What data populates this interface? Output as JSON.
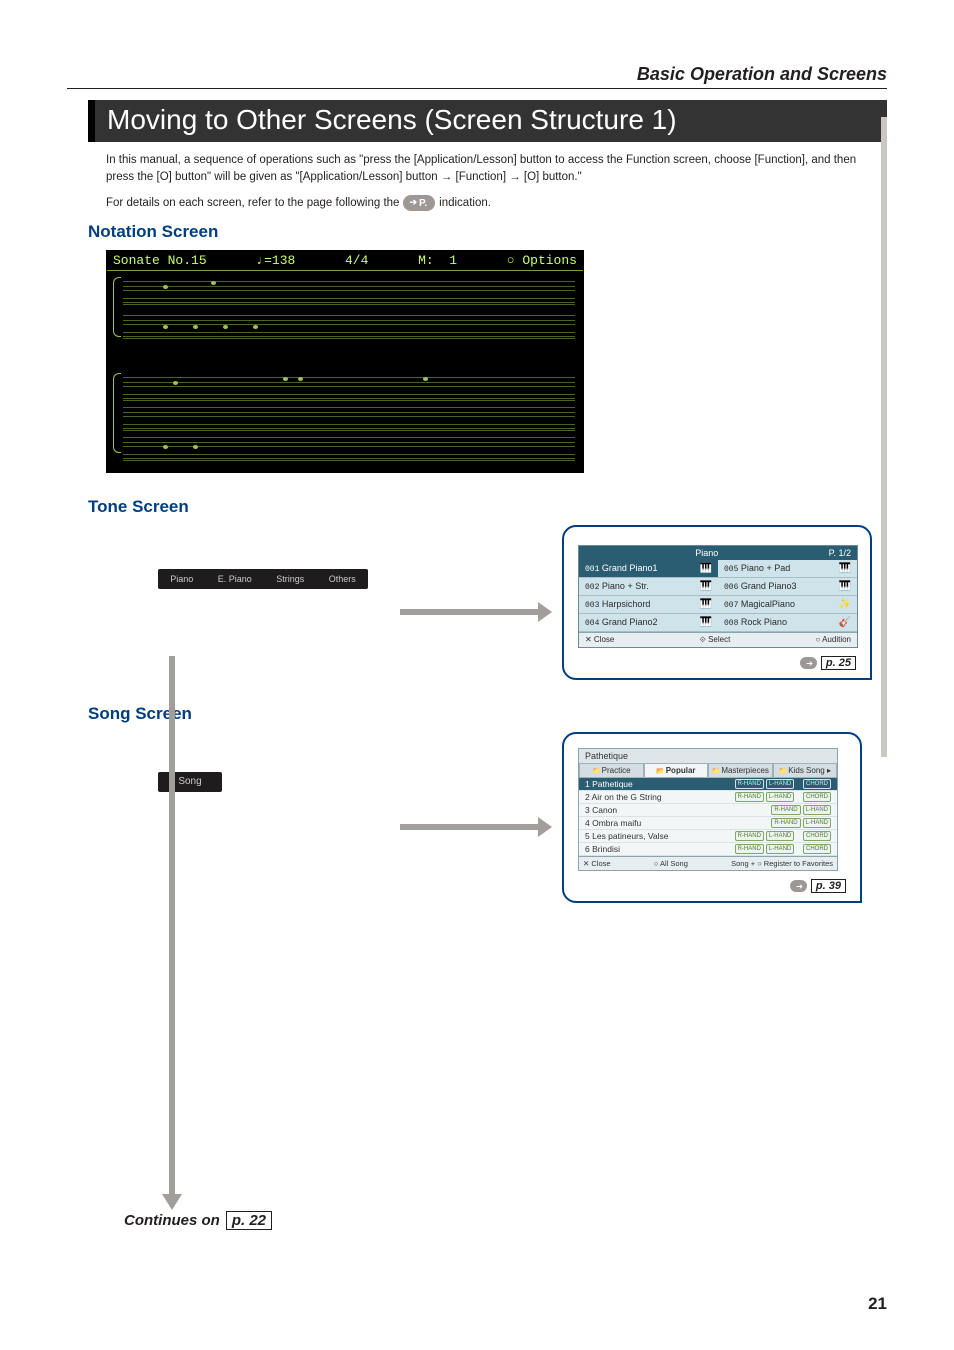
{
  "running_header": "Basic Operation and Screens",
  "section_title": "Moving to Other Screens (Screen Structure 1)",
  "intro_p1": "In this manual, a sequence of operations such as \"press the [Application/Lesson] button to access the Function screen, choose [Function], and then press the [O] button\" will be given as \"[Application/Lesson] button → [Function] → [O] button.\"",
  "intro_p2a": "For details on each screen, refer to the page following the",
  "intro_pill": "P.",
  "intro_p2b": "indication.",
  "notation": {
    "heading": "Notation Screen",
    "title": "Sonate No.15",
    "tempo": "♩=138",
    "timesig": "4/4",
    "measure": "M:  1",
    "options": "○ Options"
  },
  "tone": {
    "heading": "Tone Screen",
    "bar": [
      "Piano",
      "E. Piano",
      "Strings",
      "Others"
    ],
    "head_c": "Piano",
    "head_r": "P. 1/2",
    "items": [
      {
        "no": "001",
        "name": "Grand Piano1",
        "sel": true
      },
      {
        "no": "005",
        "name": "Piano + Pad"
      },
      {
        "no": "002",
        "name": "Piano + Str."
      },
      {
        "no": "006",
        "name": "Grand Piano3"
      },
      {
        "no": "003",
        "name": "Harpsichord"
      },
      {
        "no": "007",
        "name": "MagicalPiano"
      },
      {
        "no": "004",
        "name": "Grand Piano2"
      },
      {
        "no": "008",
        "name": "Rock Piano"
      }
    ],
    "foot": [
      "✕ Close",
      "⟐ Select",
      "○ Audition"
    ],
    "page_ref": "p. 25"
  },
  "song": {
    "heading": "Song Screen",
    "bar": "Song",
    "title": "Pathetique",
    "tabs": [
      {
        "label": "Practice",
        "icon": "📁"
      },
      {
        "label": "Popular",
        "icon": "📂",
        "active": true
      },
      {
        "label": "Masterpieces",
        "icon": "📁"
      },
      {
        "label": "Kids Song",
        "icon": "📁",
        "arrow": "▸"
      }
    ],
    "rows": [
      {
        "n": "1",
        "t": "Pathetique",
        "sel": true,
        "b": [
          "R-HAND",
          "L-HAND"
        ],
        "c": [
          "CHORD"
        ]
      },
      {
        "n": "2",
        "t": "Air on the G String",
        "b": [
          "R-HAND",
          "L-HAND"
        ],
        "c": [
          "CHORD"
        ]
      },
      {
        "n": "3",
        "t": "Canon",
        "b": [
          "R-HAND",
          "L-HAND"
        ],
        "c": []
      },
      {
        "n": "4",
        "t": "Ombra maifu",
        "b": [
          "R-HAND",
          "L-HAND"
        ],
        "c": []
      },
      {
        "n": "5",
        "t": "Les patineurs, Valse",
        "b": [
          "R-HAND",
          "L-HAND"
        ],
        "c": [
          "CHORD"
        ]
      },
      {
        "n": "6",
        "t": "Brindisi",
        "b": [
          "R-HAND",
          "L-HAND"
        ],
        "c": [
          "CHORD"
        ]
      }
    ],
    "foot": [
      "✕ Close",
      "○ All Song",
      "Song + ○ Register to Favorites"
    ],
    "page_ref": "p. 39"
  },
  "continues_text": "Continues on",
  "continues_ref": "p. 22",
  "page_number": "21"
}
